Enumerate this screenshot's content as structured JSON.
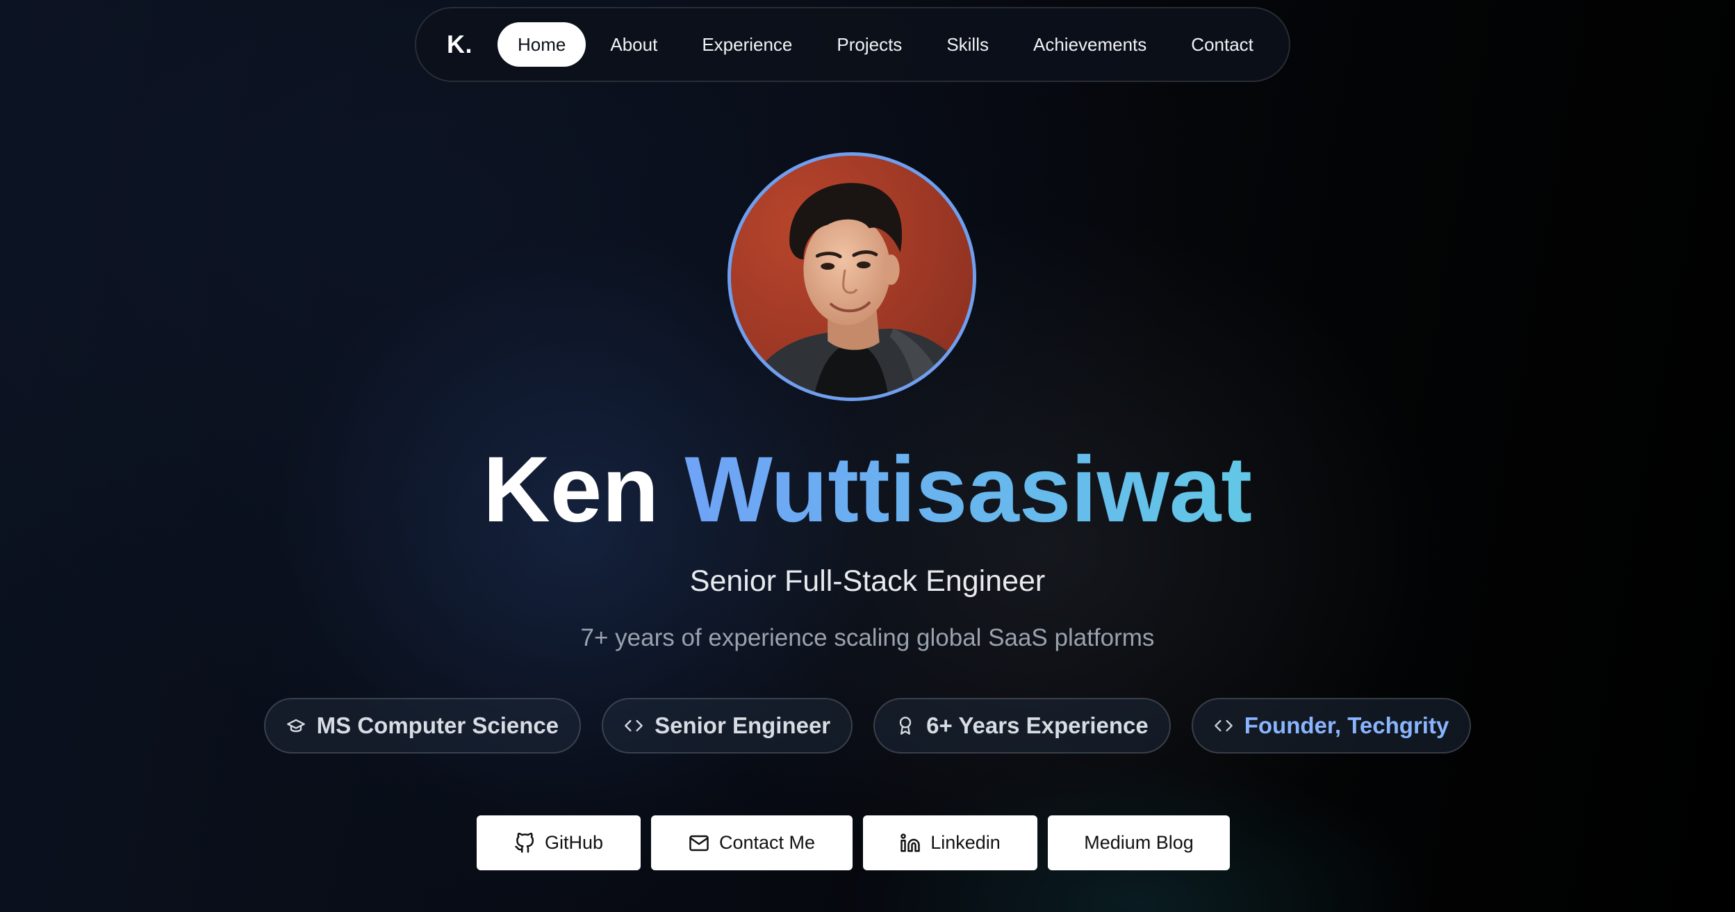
{
  "nav": {
    "logo": "K.",
    "items": [
      {
        "label": "Home",
        "active": true
      },
      {
        "label": "About"
      },
      {
        "label": "Experience"
      },
      {
        "label": "Projects"
      },
      {
        "label": "Skills"
      },
      {
        "label": "Achievements"
      },
      {
        "label": "Contact"
      }
    ]
  },
  "hero": {
    "first_name": "Ken",
    "last_name": "Wuttisasiwat",
    "title": "Senior Full-Stack Engineer",
    "subtitle": "7+ years of experience scaling global SaaS platforms"
  },
  "badges": [
    {
      "label": "MS Computer Science",
      "icon": "graduation-cap-icon"
    },
    {
      "label": "Senior Engineer",
      "icon": "code-icon"
    },
    {
      "label": "6+ Years Experience",
      "icon": "award-icon"
    },
    {
      "label": "Founder, Techgrity",
      "icon": "code-icon",
      "accent": true
    }
  ],
  "buttons": [
    {
      "label": "GitHub",
      "icon": "github-icon"
    },
    {
      "label": "Contact Me",
      "icon": "mail-icon"
    },
    {
      "label": "Linkedin",
      "icon": "linkedin-icon"
    },
    {
      "label": "Medium Blog"
    }
  ],
  "colors": {
    "accent_start": "#6fa3f6",
    "accent_end": "#62c8e6",
    "avatar_ring": "#6f9ff0",
    "badge_accent_text": "#8ab4ff"
  }
}
